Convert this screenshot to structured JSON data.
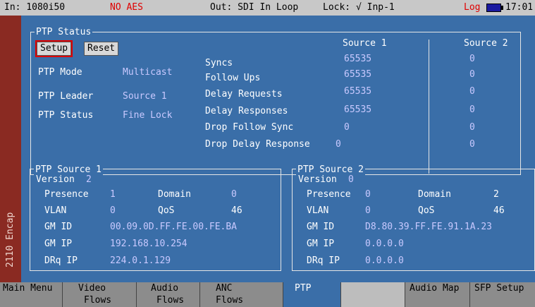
{
  "status_bar": {
    "input": "In: 1080i50",
    "aes": "NO AES",
    "output": "Out: SDI In Loop",
    "lock": "Lock: √ Inp-1",
    "log": "Log",
    "time": "17:01"
  },
  "side_tab": "2110 Encap",
  "ptp_status": {
    "title": "PTP Status",
    "setup_label": "Setup",
    "reset_label": "Reset",
    "rows": [
      {
        "label": "PTP Mode",
        "value": "Multicast"
      },
      {
        "label": "PTP Leader",
        "value": "Source 1"
      },
      {
        "label": "PTP Status",
        "value": "Fine Lock"
      }
    ],
    "source1_header": "Source 1",
    "source2_header": "Source 2",
    "counters": [
      {
        "label": "Syncs",
        "s1": "65535",
        "s2": "0"
      },
      {
        "label": "Follow Ups",
        "s1": "65535",
        "s2": "0"
      },
      {
        "label": "Delay Requests",
        "s1": "65535",
        "s2": "0"
      },
      {
        "label": "Delay Responses",
        "s1": "65535",
        "s2": "0"
      },
      {
        "label": "Drop Follow Sync",
        "s1": "0",
        "s2": "0"
      },
      {
        "label": "Drop Delay Response",
        "s1": "0",
        "s2": "0"
      }
    ]
  },
  "source1": {
    "title": "PTP Source 1",
    "version_label": "Version",
    "version": "2",
    "presence_label": "Presence",
    "presence": "1",
    "domain_label": "Domain",
    "domain": "0",
    "vlan_label": "VLAN",
    "vlan": "0",
    "qos_label": "QoS",
    "qos": "46",
    "gmid_label": "GM ID",
    "gmid": "00.09.0D.FF.FE.00.FE.BA",
    "gmip_label": "GM IP",
    "gmip": "192.168.10.254",
    "drqip_label": "DRq IP",
    "drqip": "224.0.1.129"
  },
  "source2": {
    "title": "PTP Source 2",
    "version_label": "Version",
    "version": "0",
    "presence_label": "Presence",
    "presence": "0",
    "domain_label": "Domain",
    "domain": "2",
    "vlan_label": "VLAN",
    "vlan": "0",
    "qos_label": "QoS",
    "qos": "46",
    "gmid_label": "GM ID",
    "gmid": "D8.80.39.FF.FE.91.1A.23",
    "gmip_label": "GM IP",
    "gmip": "0.0.0.0",
    "drqip_label": "DRq IP",
    "drqip": "0.0.0.0"
  },
  "softkeys": {
    "main_menu": "Main Menu",
    "video_1": "Video",
    "video_2": "Flows",
    "audio_1": "Audio",
    "audio_2": "Flows",
    "anc_1": "ANC",
    "anc_2": "Flows",
    "ptp": "PTP",
    "audio_map": "Audio Map",
    "sfp_setup": "SFP Setup"
  }
}
